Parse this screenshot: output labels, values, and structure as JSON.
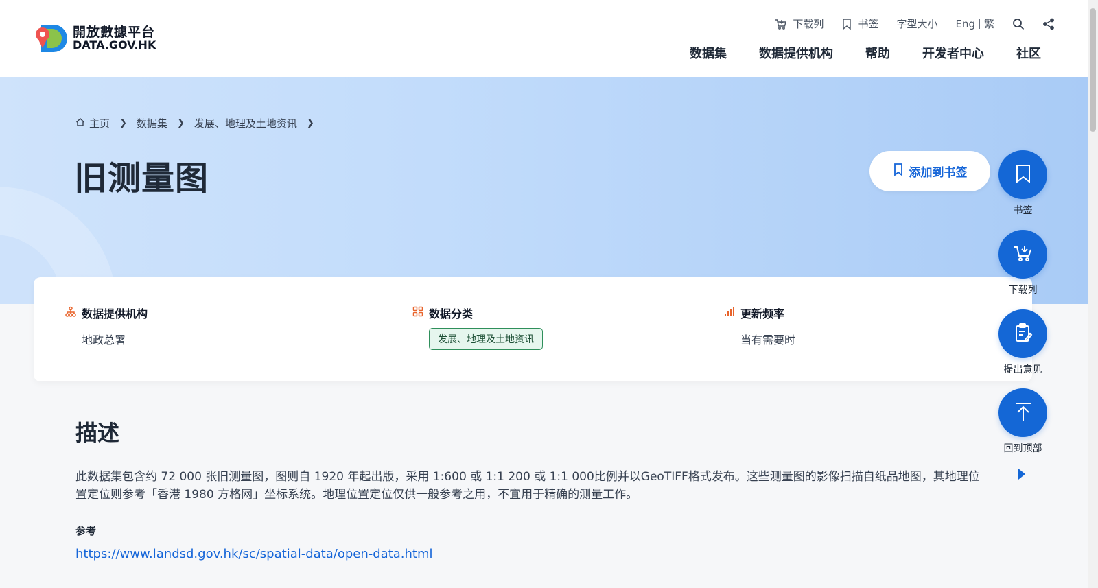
{
  "header": {
    "logo_cn": "開放數據平台",
    "logo_en": "DATA.GOV.HK",
    "topbar": {
      "download_list": "下载列",
      "bookmark": "书签",
      "font_size": "字型大小",
      "lang_en": "Eng",
      "lang_tc": "繁"
    },
    "nav": [
      "数据集",
      "数据提供机构",
      "帮助",
      "开发者中心",
      "社区"
    ]
  },
  "breadcrumb": [
    "主页",
    "数据集",
    "发展、地理及土地资讯"
  ],
  "page_title": "旧测量图",
  "bookmark_button": "添加到书签",
  "info": {
    "provider_label": "数据提供机构",
    "provider_value": "地政总署",
    "category_label": "数据分类",
    "category_value": "发展、地理及土地资讯",
    "frequency_label": "更新频率",
    "frequency_value": "当有需要时"
  },
  "description": {
    "title": "描述",
    "text": "此数据集包含约 72 000 张旧测量图，图则自 1920 年起出版，采用 1:600 或 1:1 200 或 1:1 000比例并以GeoTIFF格式发布。这些测量图的影像扫描自纸品地图，其地理位置定位则参考「香港 1980 方格网」坐标系统。地理位置定位仅供一般参考之用，不宜用于精确的测量工作。",
    "ref_label": "参考",
    "ref_link": "https://www.landsd.gov.hk/sc/spatial-data/open-data.html"
  },
  "fab": {
    "bookmark": "书签",
    "download_list": "下载列",
    "feedback": "提出意见",
    "back_to_top": "回到顶部"
  },
  "colors": {
    "primary": "#1467d6",
    "link": "#1565d8",
    "tag_border": "#2f8f5b",
    "icon_orange": "#e8642c"
  }
}
